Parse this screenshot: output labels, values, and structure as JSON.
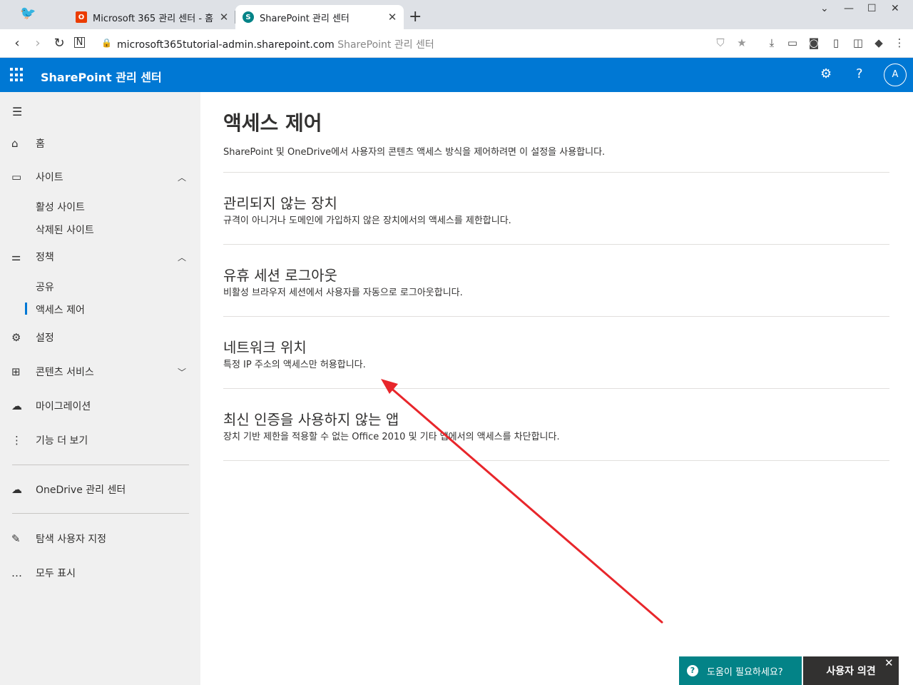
{
  "browser": {
    "tabs": [
      {
        "title": "Microsoft 365 관리 센터 - 홈",
        "close": "✕"
      },
      {
        "title": "SharePoint 관리 센터",
        "close": "✕"
      }
    ],
    "new_tab": "+",
    "url_host": "microsoft365tutorial-admin.sharepoint.com",
    "url_page_title": "SharePoint 관리 센터"
  },
  "appbar": {
    "title": "SharePoint 관리 센터",
    "help": "?",
    "avatar_initial": "A"
  },
  "sidebar": {
    "items": [
      {
        "label": "홈",
        "icon": "home-icon"
      },
      {
        "label": "사이트",
        "icon": "sites-icon"
      },
      {
        "label": "정책",
        "icon": "policy-icon"
      },
      {
        "label": "설정",
        "icon": "gear-icon"
      },
      {
        "label": "콘텐츠 서비스",
        "icon": "content-icon"
      },
      {
        "label": "마이그레이션",
        "icon": "cloud-upload-icon"
      },
      {
        "label": "기능 더 보기",
        "icon": "more-icon"
      },
      {
        "label": "OneDrive 관리 센터",
        "icon": "onedrive-icon"
      },
      {
        "label": "탐색 사용자 지정",
        "icon": "pencil-icon"
      },
      {
        "label": "모두 표시",
        "icon": "ellipsis-icon"
      }
    ],
    "sites_sub": [
      "활성 사이트",
      "삭제된 사이트"
    ],
    "policies_sub": [
      "공유",
      "액세스 제어"
    ]
  },
  "main": {
    "title": "액세스 제어",
    "description": "SharePoint 및 OneDrive에서 사용자의 콘텐츠 액세스 방식을 제어하려면 이 설정을 사용합니다.",
    "sections": [
      {
        "title": "관리되지 않는 장치",
        "desc": "규격이 아니거나 도메인에 가입하지 않은 장치에서의 액세스를 제한합니다."
      },
      {
        "title": "유휴 세션 로그아웃",
        "desc": "비활성 브라우저 세션에서 사용자를 자동으로 로그아웃합니다."
      },
      {
        "title": "네트워크 위치",
        "desc": "특정 IP 주소의 액세스만 허용합니다."
      },
      {
        "title": "최신 인증을 사용하지 않는 앱",
        "desc": "장치 기반 제한을 적용할 수 없는 Office 2010 및 기타 앱에서의 액세스를 차단합니다."
      }
    ]
  },
  "feedback": {
    "help_label": "도움이 필요하세요?",
    "feedback_label": "사용자 의견",
    "close": "✕"
  },
  "colors": {
    "brand": "#0078d4",
    "help": "#038387",
    "annotation": "#e8262b"
  }
}
